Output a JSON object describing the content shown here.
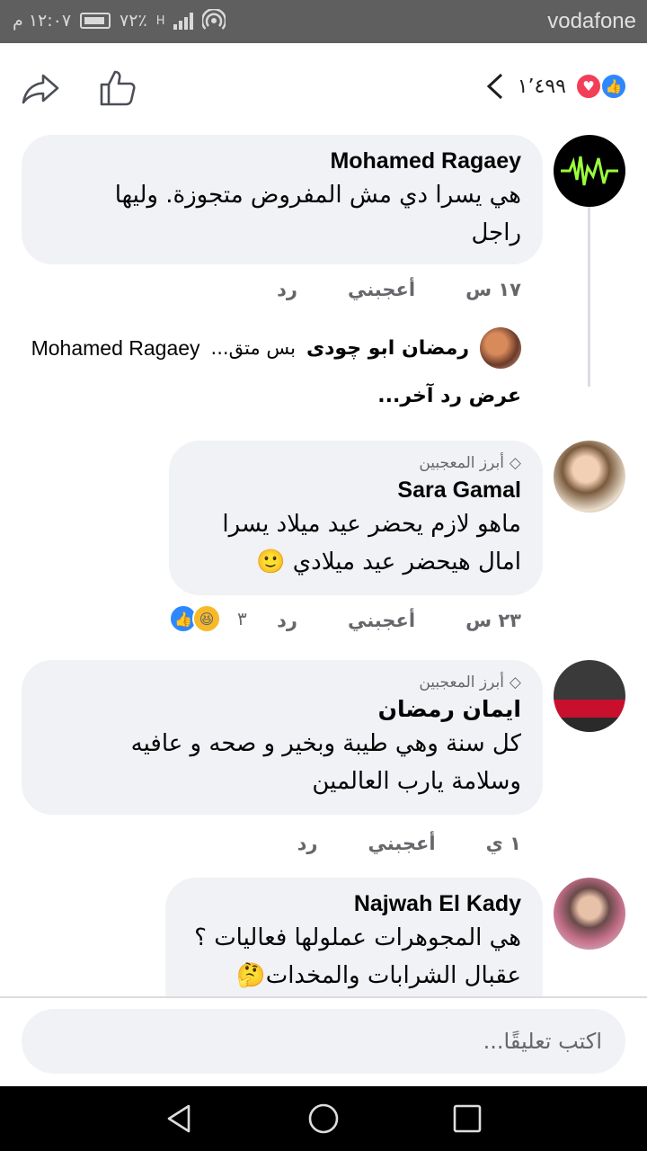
{
  "status_bar": {
    "carrier": "vodafone",
    "time": "١٢:٠٧ م",
    "battery": "٧٢٪",
    "network": "H"
  },
  "top_bar": {
    "reaction_count": "١٬٤٩٩",
    "reaction_icons": [
      "like-icon",
      "love-icon"
    ]
  },
  "comments": [
    {
      "author": "Mohamed Ragaey",
      "text_line1": "هي يسرا دي مش المفروض متجوزة. وليها",
      "text_line2": "راجل",
      "time": "١٧ س",
      "like_label": "أعجبني",
      "reply_label": "رد",
      "reply_preview": {
        "name": "رمضان ابو چودى",
        "snippet": "بس متق...",
        "reply_to": "Mohamed Ragaey"
      },
      "more_replies_label": "عرض رد آخر..."
    },
    {
      "badge": "أبرز المعجبين",
      "author": "Sara Gamal",
      "text_line1": "ماهو لازم يحضر عيد ميلاد يسرا",
      "text_line2": "امال هيحضر عيد ميلادي 🙂",
      "time": "٢٣ س",
      "like_label": "أعجبني",
      "reply_label": "رد",
      "reaction_count": "٣",
      "reaction_icons": [
        "like-icon",
        "haha-icon"
      ]
    },
    {
      "badge": "أبرز المعجبين",
      "author": "ايمان رمضان",
      "text_line1": "كل سنة وهي طيبة وبخير و صحه و عافيه",
      "text_line2": "وسلامة يارب العالمين",
      "time": "١ ي",
      "like_label": "أعجبني",
      "reply_label": "رد"
    },
    {
      "author": "Najwah El Kady",
      "text_line1": "هي المجوهرات عملولها فعاليات ؟",
      "text_line2": "عقبال الشرابات والمخدات🤔"
    }
  ],
  "composer": {
    "placeholder": "اكتب تعليقًا..."
  },
  "colors": {
    "bubble": "#f0f2f5",
    "like_blue": "#2d88ff",
    "love_red": "#f33e58",
    "meta_gray": "#65676b",
    "status_bar": "#5f5f5f"
  }
}
